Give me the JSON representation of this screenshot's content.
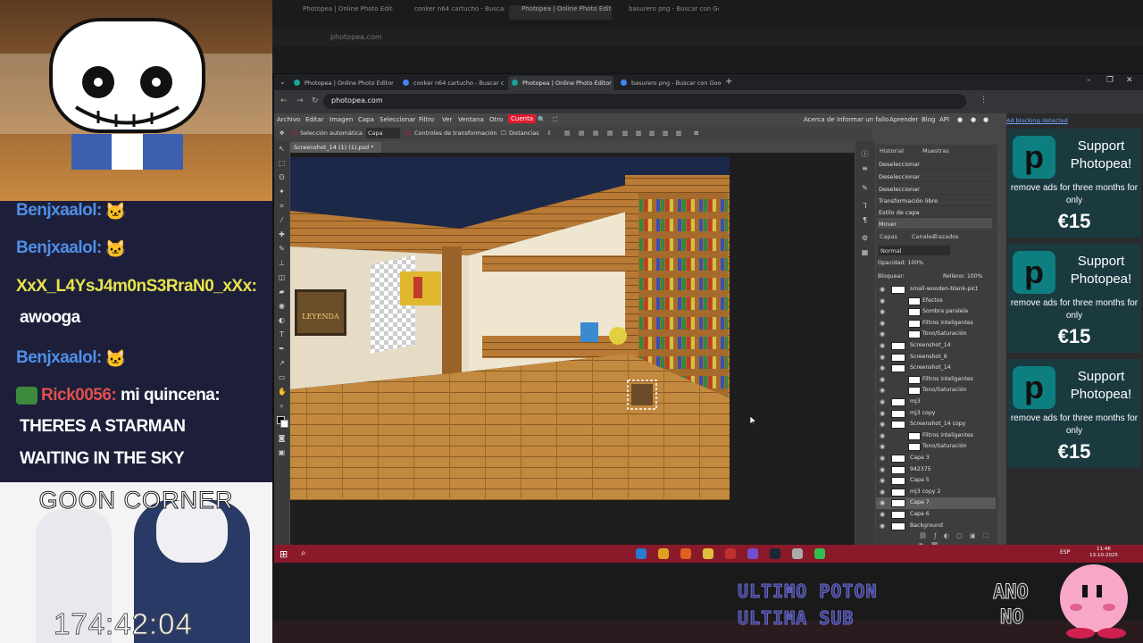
{
  "chat": {
    "lines": [
      {
        "user": "Benjxaalol:",
        "msg": ""
      },
      {
        "user": "Benjxaalol:",
        "msg": ""
      },
      {
        "user": "XxX_L4YsJ4m0nS3RraN0_xXx:",
        "msg": ""
      },
      {
        "user": "",
        "msg": "awooga"
      },
      {
        "user": "Benjxaalol:",
        "msg": ""
      },
      {
        "user": "Rick0056:",
        "msg": "mi quincena:"
      },
      {
        "user": "",
        "msg": "THERES A STARMAN"
      },
      {
        "user": "",
        "msg": "WAITING IN THE SKY"
      }
    ]
  },
  "overlay": {
    "corner_title": "GOON CORNER",
    "timer": "174:42:04",
    "bottom_text_1": "ULTIMO POTON",
    "bottom_text_2": "ULTIMA SUB",
    "anono_1": "ANO",
    "anono_2": "NO"
  },
  "bg_browser": {
    "tabs": [
      "Photopea | Online Photo Editor",
      "conker n64 cartucho - Buscar con",
      "Photopea | Online Photo Editor",
      "basurero png - Buscar con Goo"
    ],
    "url": "photopea.com"
  },
  "browser": {
    "tabs": [
      {
        "label": "Photopea | Online Photo Editor",
        "color": "#1aa39a"
      },
      {
        "label": "conker n64 cartucho - Buscar c",
        "color": "#4285f4"
      },
      {
        "label": "Photopea | Online Photo Editor",
        "color": "#1aa39a"
      },
      {
        "label": "basurero png - Buscar con Goo",
        "color": "#4285f4"
      }
    ],
    "new_tab": "+",
    "url": "photopea.com"
  },
  "photopea": {
    "menu": [
      "Archivo",
      "Editar",
      "Imagen",
      "Capa",
      "Seleccionar",
      "Filtro",
      "Ver",
      "Ventana",
      "Otro",
      "Cuenta"
    ],
    "menu_right": [
      "Acerca de",
      "Informar un fallo",
      "Aprender",
      "Blog",
      "API"
    ],
    "options": {
      "auto_select": "Selección automática",
      "layer_select": "Capa",
      "transform_controls": "Controles de transformación",
      "distances": "Distancias"
    },
    "doc_tab": "Screenshot_14 (1) (1).psd *",
    "doc_close": "×",
    "history": {
      "tabs": [
        "Historial",
        "Muestras"
      ],
      "items": [
        "Deseleccionar",
        "Deseleccionar",
        "Deseleccionar",
        "Transformación libre",
        "Estilo de capa",
        "Mover"
      ]
    },
    "layers": {
      "tabs": [
        "Capas",
        "Canales",
        "Trazados"
      ],
      "blend_mode": "Normal",
      "opacity_label": "Opacidad:",
      "opacity_value": "100%",
      "lock_label": "Bloquear:",
      "fill_label": "Relleno:",
      "fill_value": "100%",
      "items": [
        {
          "name": "small-wooden-blank-pict",
          "sub": false
        },
        {
          "name": "Efectos",
          "sub": true
        },
        {
          "name": "Sombra paralela",
          "sub": true
        },
        {
          "name": "Filtros inteligentes",
          "sub": true
        },
        {
          "name": "Tono/Saturación",
          "sub": true
        },
        {
          "name": "Screenshot_14",
          "sub": false
        },
        {
          "name": "Screenshot_6",
          "sub": false
        },
        {
          "name": "Screenshot_14",
          "sub": false
        },
        {
          "name": "Filtros inteligentes",
          "sub": true
        },
        {
          "name": "Tono/Saturación",
          "sub": true
        },
        {
          "name": "mj3",
          "sub": false
        },
        {
          "name": "mj3 copy",
          "sub": false
        },
        {
          "name": "Screenshot_14 copy",
          "sub": false
        },
        {
          "name": "Filtros inteligentes",
          "sub": true
        },
        {
          "name": "Tono/Saturación",
          "sub": true
        },
        {
          "name": "Capa 3",
          "sub": false
        },
        {
          "name": "942375",
          "sub": false
        },
        {
          "name": "Capa 5",
          "sub": false
        },
        {
          "name": "mj3 copy 2",
          "sub": false
        },
        {
          "name": "Capa 7",
          "sub": false
        },
        {
          "name": "Capa 6",
          "sub": false
        },
        {
          "name": "Background",
          "sub": false
        }
      ]
    }
  },
  "ads": {
    "note": "Ad blocking detected",
    "cards": [
      {
        "title": "Support Photopea!",
        "sub": "remove ads for three months for only",
        "price": "€15"
      },
      {
        "title": "Support Photopea!",
        "sub": "remove ads for three months for only",
        "price": "€15"
      },
      {
        "title": "Support Photopea!",
        "sub": "remove ads for three months for only",
        "price": "€15"
      }
    ]
  },
  "taskbar": {
    "lang": "ESP",
    "time": "11:46",
    "date": "13-10-2025"
  },
  "scene": {
    "poster_text": "LEYENDA"
  },
  "colors": {
    "accent_menu": "#e01a2f",
    "taskbar": "#8a1a2a",
    "ad_bg": "#1a3a40",
    "ad_logo": "#0e7f80"
  }
}
